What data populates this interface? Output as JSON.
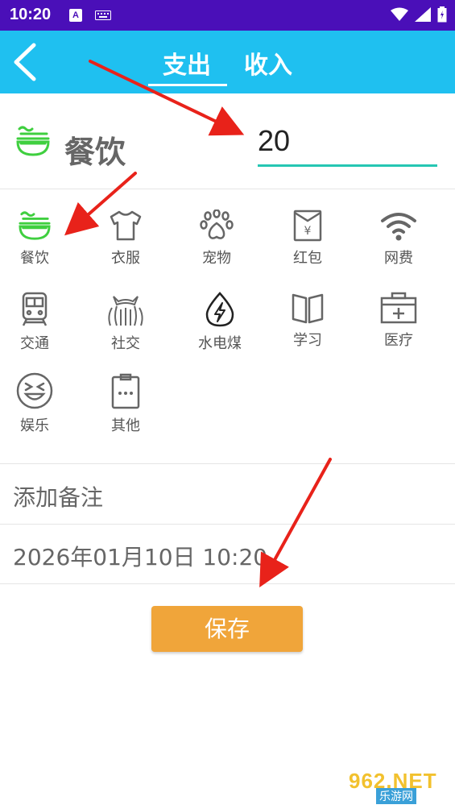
{
  "status_bar": {
    "time": "10:20",
    "a_badge": "A"
  },
  "header": {
    "tab_expense": "支出",
    "tab_income": "收入"
  },
  "selected": {
    "category": "餐饮",
    "amount": "20"
  },
  "categories": [
    {
      "label": "餐饮",
      "icon": "noodle-bowl-icon"
    },
    {
      "label": "衣服",
      "icon": "tshirt-icon"
    },
    {
      "label": "宠物",
      "icon": "paw-icon"
    },
    {
      "label": "红包",
      "icon": "red-envelope-icon"
    },
    {
      "label": "网费",
      "icon": "wifi-icon"
    },
    {
      "label": "交通",
      "icon": "train-icon"
    },
    {
      "label": "社交",
      "icon": "cat-icon"
    },
    {
      "label": "水电煤",
      "icon": "water-drop-bolt-icon"
    },
    {
      "label": "学习",
      "icon": "open-book-icon"
    },
    {
      "label": "医疗",
      "icon": "medical-kit-icon"
    },
    {
      "label": "娱乐",
      "icon": "laughing-face-icon"
    },
    {
      "label": "其他",
      "icon": "clipboard-dots-icon"
    }
  ],
  "note_placeholder": "添加备注",
  "datetime": "2026年01月10日 10:20",
  "save_label": "保存",
  "watermark": {
    "logo": "962.NET",
    "sub": "乐游网"
  },
  "colors": {
    "status_bar": "#4a0fb8",
    "header": "#1fc0f0",
    "accent_green": "#3fcf3f",
    "underline": "#26c6b3",
    "save": "#f0a53a",
    "arrow": "#e8221a"
  }
}
